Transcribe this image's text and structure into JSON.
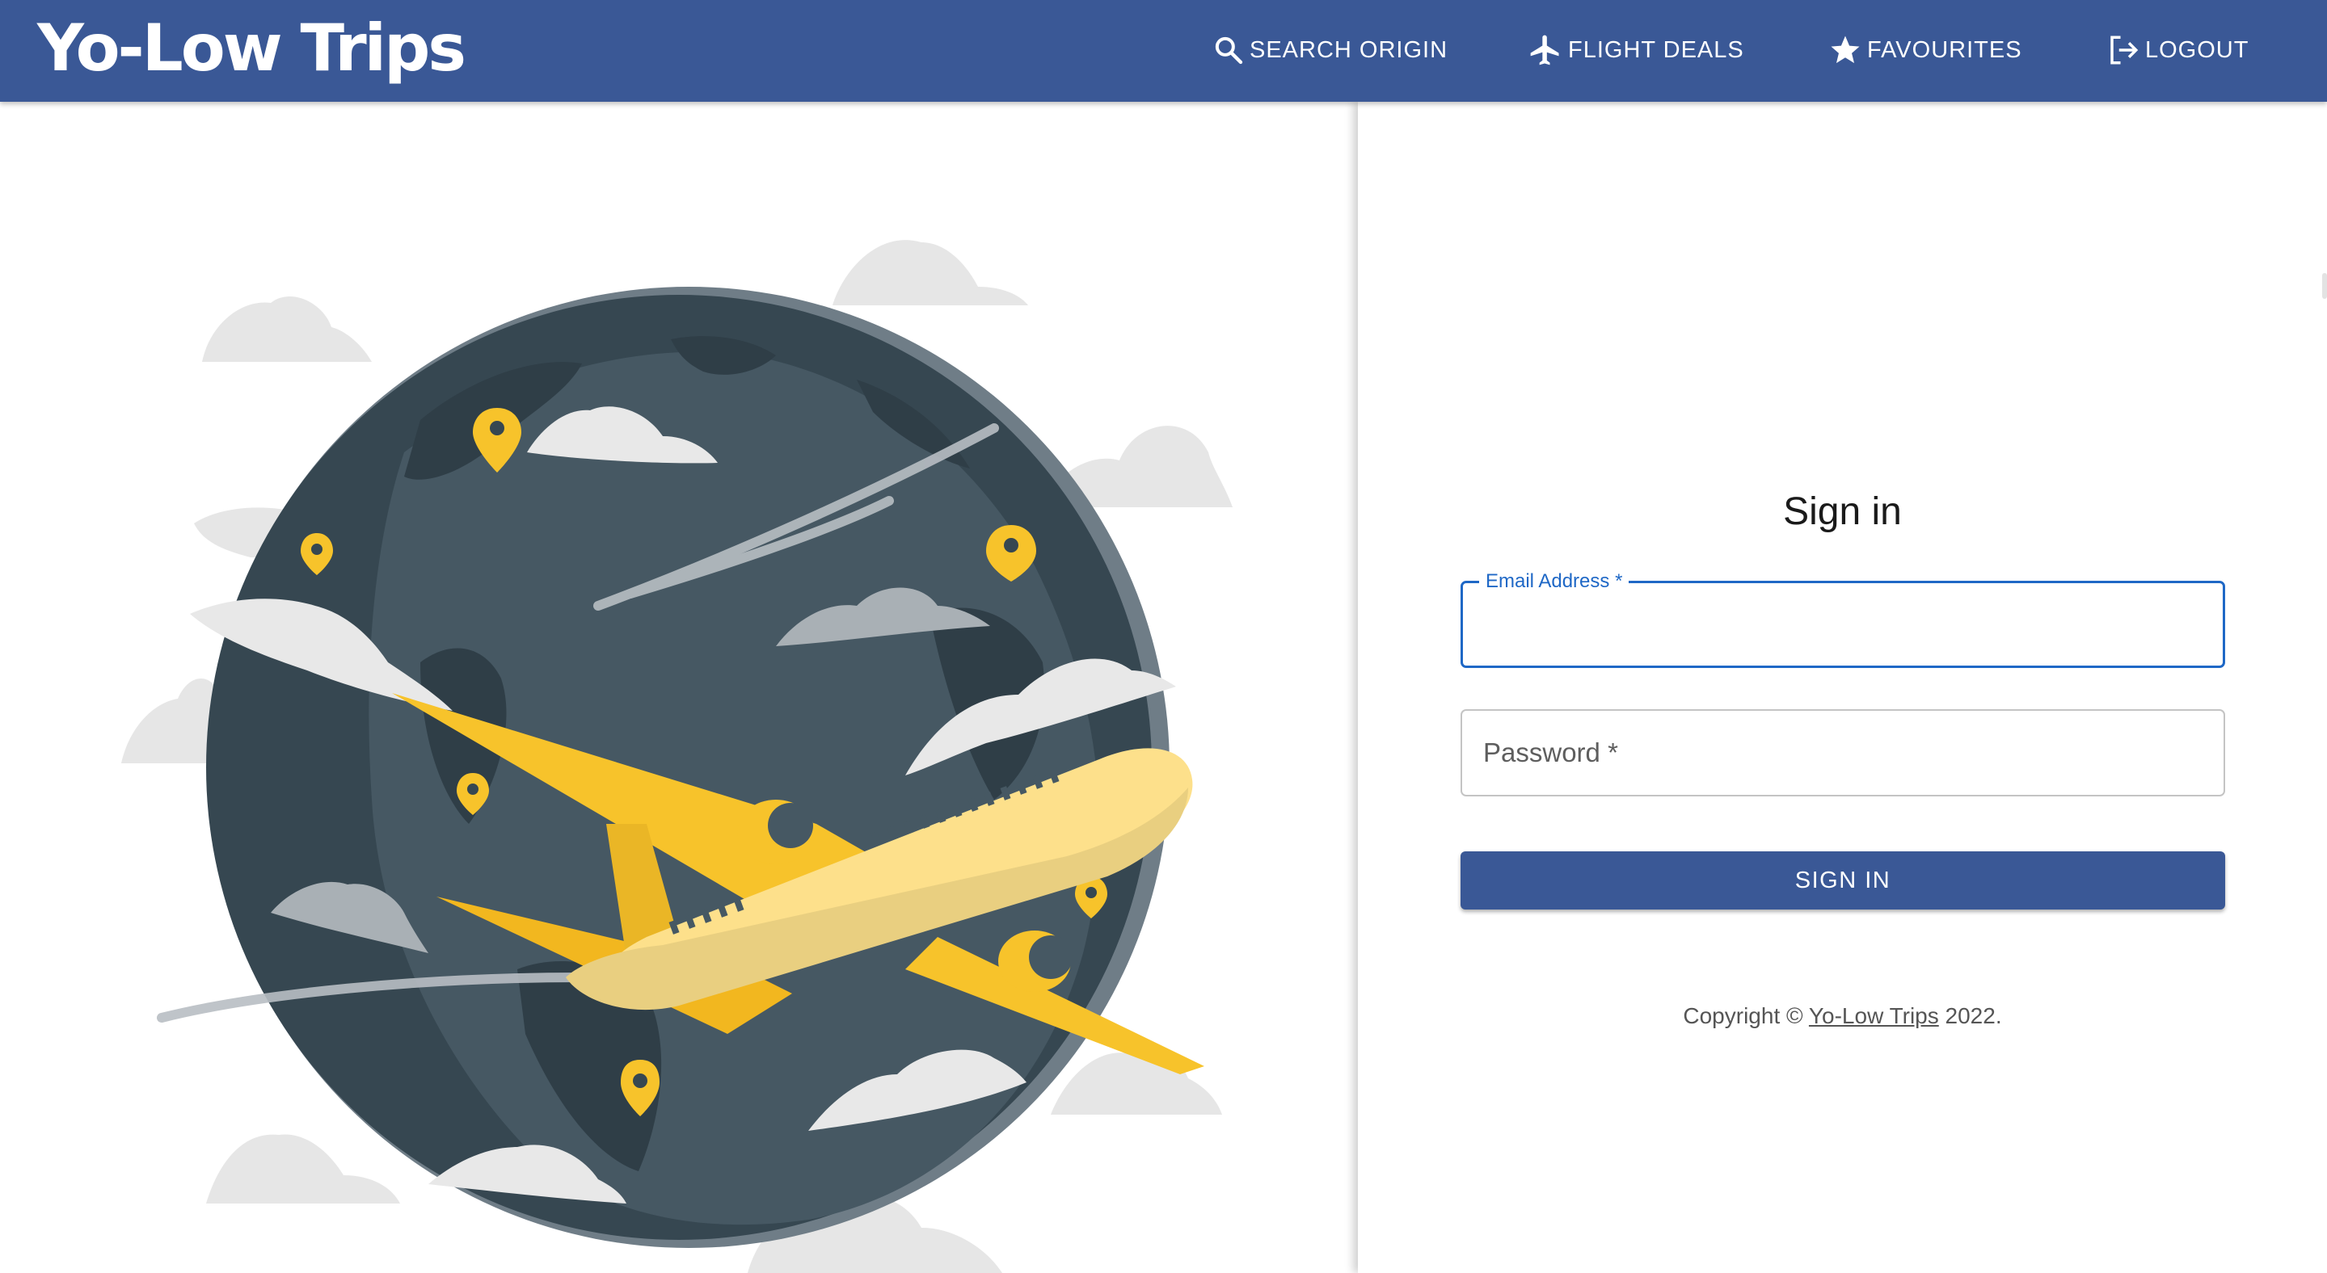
{
  "app": {
    "brand": "Yo-Low Trips",
    "colors": {
      "primary": "#3a5896",
      "focus": "#1f68c6",
      "accent_yellow": "#f7c32b"
    }
  },
  "nav": {
    "items": [
      {
        "label": "SEARCH ORIGIN",
        "icon": "search-icon"
      },
      {
        "label": "FLIGHT DEALS",
        "icon": "airplane-icon"
      },
      {
        "label": "FAVOURITES",
        "icon": "star-icon"
      },
      {
        "label": "LOGOUT",
        "icon": "logout-icon"
      }
    ]
  },
  "signin": {
    "title": "Sign in",
    "email": {
      "label": "Email Address",
      "required_mark": "*",
      "value": ""
    },
    "password": {
      "label": "Password",
      "required_mark": "*",
      "value": ""
    },
    "submit_label": "SIGN IN"
  },
  "footer": {
    "prefix": "Copyright © ",
    "link_text": "Yo-Low Trips",
    "suffix": " 2022."
  },
  "illustration": {
    "name": "globe-with-airplane"
  }
}
